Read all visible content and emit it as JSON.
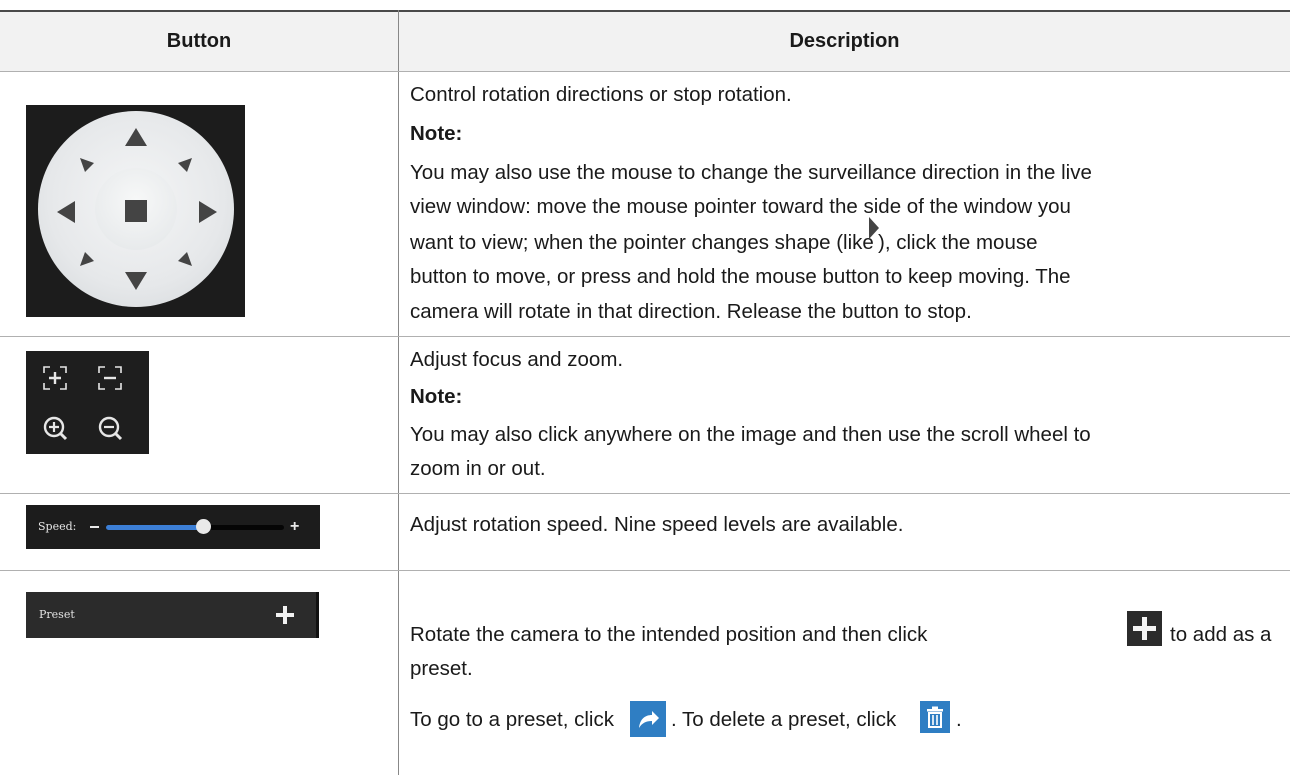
{
  "table": {
    "headers": {
      "button": "Button",
      "description": "Description"
    },
    "rows": [
      {
        "id": "direction",
        "lines": [
          "Control rotation directions or stop rotation.",
          "Note:",
          "You may also use the mouse to change the surveillance direction in the live",
          "view window: move the mouse pointer toward the side of the window you",
          "want to view; when the pointer changes shape (like",
          "), click the mouse",
          "button to move, or press and hold the mouse button to keep moving. The",
          "camera will rotate in that direction. Release the button to stop."
        ],
        "icons": [
          "up-arrow-icon",
          "down-arrow-icon",
          "left-arrow-icon",
          "right-arrow-icon",
          "stop-icon",
          "pointer-arrow-icon"
        ]
      },
      {
        "id": "focus-zoom",
        "lines": [
          "Adjust focus and zoom.",
          "Note:",
          "You may also click anywhere on the image and then use the scroll wheel to",
          "zoom in or out."
        ],
        "icons": [
          "focus-in-icon",
          "focus-out-icon",
          "zoom-in-icon",
          "zoom-out-icon"
        ]
      },
      {
        "id": "speed",
        "slider": {
          "label": "Speed:",
          "minus": "−",
          "plus": "+",
          "level_fraction": 0.55
        },
        "lines": [
          "Adjust rotation speed. Nine speed levels are available."
        ]
      },
      {
        "id": "preset",
        "panel_label": "Preset",
        "lines": [
          "Rotate the camera to the intended position and then click",
          "to add as a",
          "preset.",
          "To go to a preset, click",
          ". To delete a preset, click",
          "."
        ],
        "icons": [
          "add-icon",
          "goto-preset-icon",
          "delete-icon"
        ]
      }
    ]
  },
  "colors": {
    "header_bg": "#f2f2f2",
    "panel_bg": "#1c1c1c",
    "accent_blue": "#2f7ec3",
    "slider_blue": "#3c7fd6"
  }
}
